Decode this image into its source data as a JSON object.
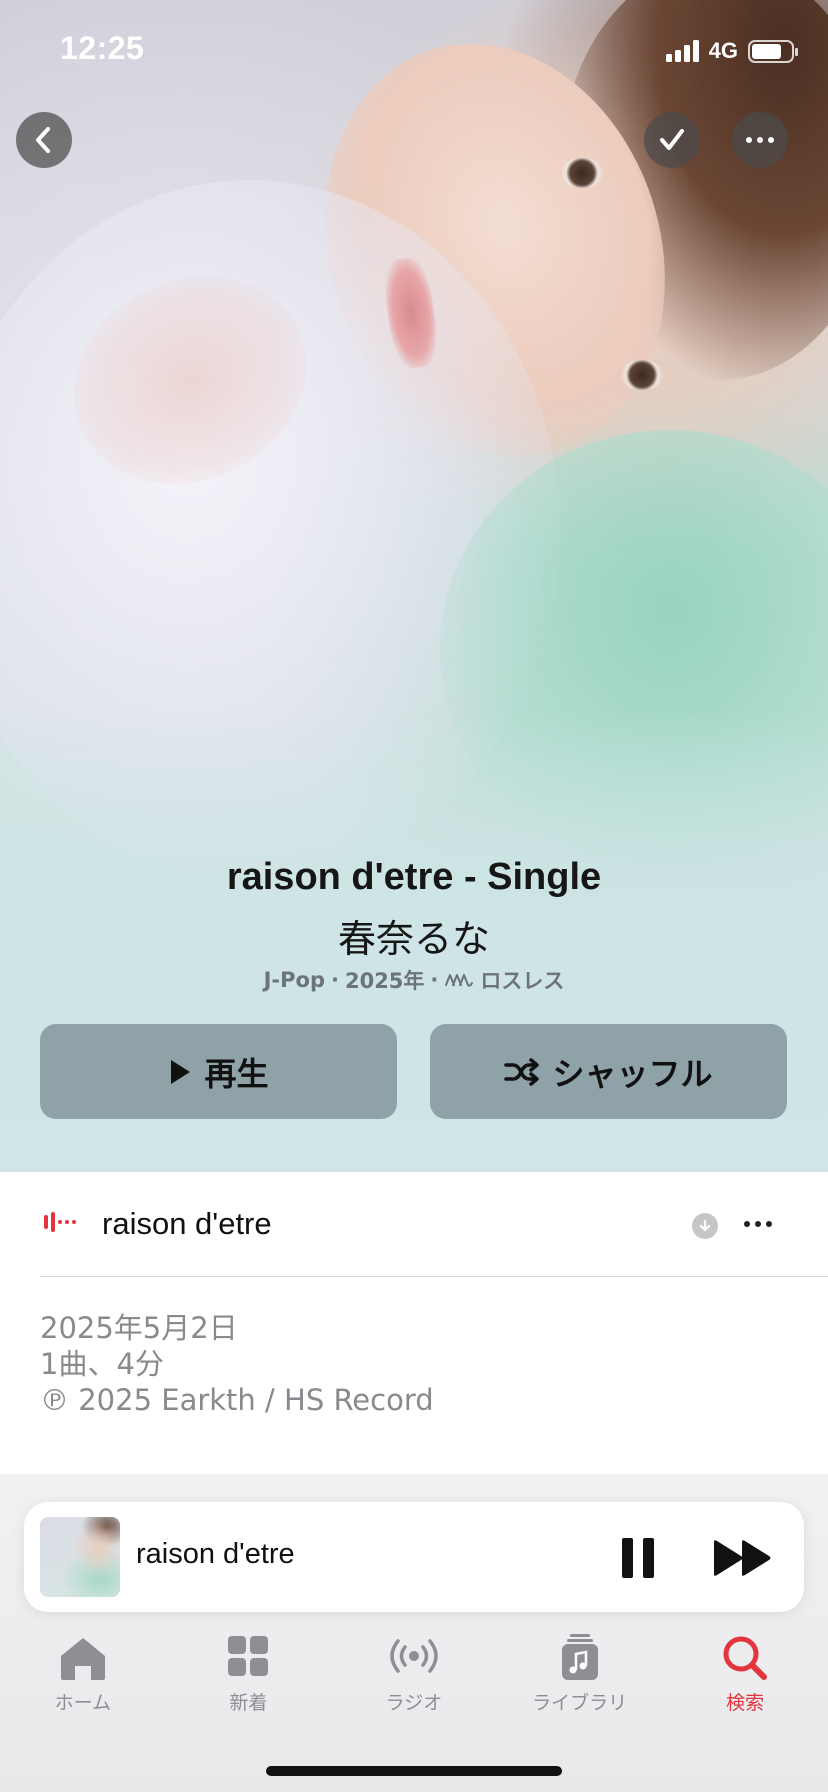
{
  "status_bar": {
    "time": "12:25",
    "network": "4G",
    "battery_level": 0.75
  },
  "album": {
    "title": "raison d'etre - Single",
    "artist": "春奈るな",
    "genre": "J-Pop",
    "year": "2025年",
    "lossless_label": "ロスレス"
  },
  "actions": {
    "play_label": "再生",
    "shuffle_label": "シャッフル"
  },
  "tracks": [
    {
      "title": "raison d'etre",
      "now_playing": true
    }
  ],
  "release": {
    "date": "2025年5月2日",
    "summary": "1曲、4分",
    "copyright": "℗ 2025 Earkth / HS Record"
  },
  "mini_player": {
    "title": "raison d'etre",
    "state": "playing"
  },
  "tabbar": {
    "items": [
      {
        "label": "ホーム",
        "icon": "home-icon"
      },
      {
        "label": "新着",
        "icon": "grid-icon"
      },
      {
        "label": "ラジオ",
        "icon": "radio-icon"
      },
      {
        "label": "ライブラリ",
        "icon": "library-icon"
      },
      {
        "label": "検索",
        "icon": "search-icon",
        "active": true
      }
    ]
  },
  "colors": {
    "accent": "#e4353f",
    "button_bg": "#8fa2a8",
    "tab_inactive": "#8e8e93"
  }
}
